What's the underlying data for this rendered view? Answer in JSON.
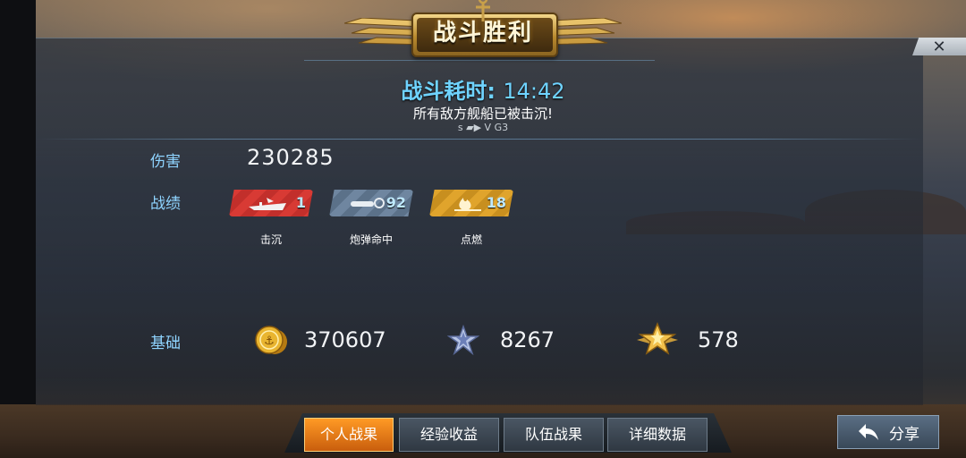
{
  "banner": {
    "title": "战斗胜利"
  },
  "header": {
    "battle_time_label": "战斗耗时:",
    "battle_time_value": "14:42",
    "result_message": "所有敌方舰船已被击沉!",
    "meta_text": "s ▰▶   V   G3"
  },
  "stats": {
    "damage_label": "伤害",
    "damage_value": "230285",
    "record_label": "战绩",
    "badges": [
      {
        "icon": "aircraft-carrier-icon",
        "count": "1",
        "label": "击沉",
        "color": "#d83a34"
      },
      {
        "icon": "shell-hit-icon",
        "count": "92",
        "label": "炮弹命中",
        "color": "#6f86a0"
      },
      {
        "icon": "fire-icon",
        "count": "18",
        "label": "点燃",
        "color": "#e0a42c"
      }
    ],
    "base_label": "基础",
    "rewards": [
      {
        "icon": "gold-coin-icon",
        "value": "370607"
      },
      {
        "icon": "silver-star-icon",
        "value": "8267"
      },
      {
        "icon": "winged-gold-star-icon",
        "value": "578"
      }
    ]
  },
  "tabs": [
    {
      "label": "个人战果",
      "active": true
    },
    {
      "label": "经验收益",
      "active": false
    },
    {
      "label": "队伍战果",
      "active": false
    },
    {
      "label": "详细数据",
      "active": false
    }
  ],
  "share": {
    "label": "分享",
    "icon": "back-arrow-icon"
  },
  "close": {
    "icon": "close-icon"
  },
  "colors": {
    "accent": "#6fd3ff",
    "label": "#8fd4ff",
    "tab_active": "#f08a1e"
  }
}
